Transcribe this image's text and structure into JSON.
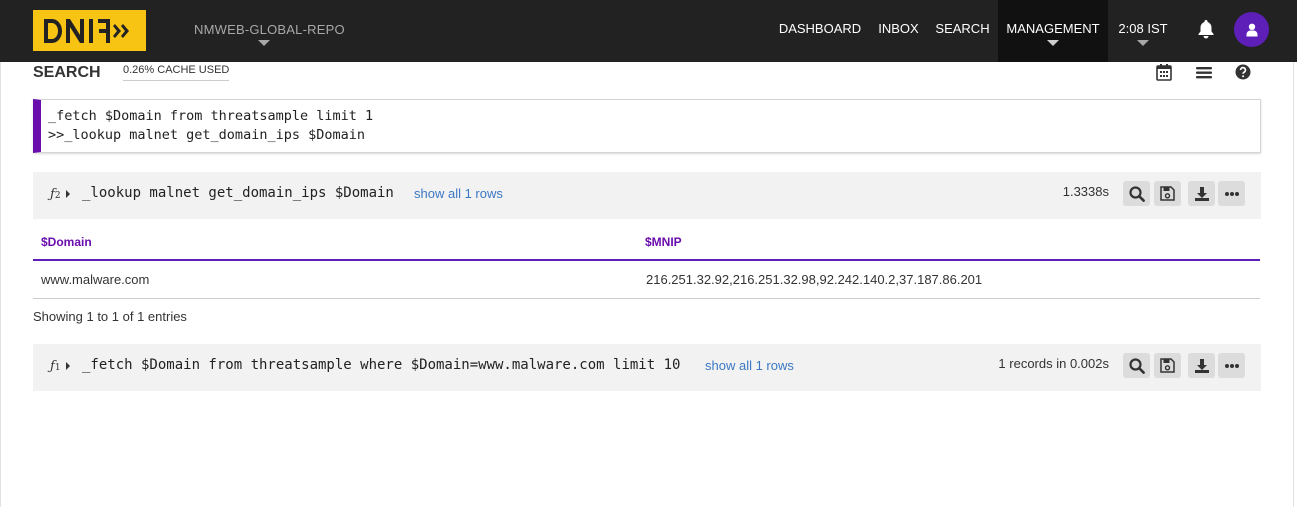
{
  "app": {
    "logo_text": "DNIF",
    "repo_name": "NMWEB-GLOBAL-REPO",
    "brand_color": "#f7c413",
    "accent_color": "#6a0dad"
  },
  "nav": {
    "dashboard": "DASHBOARD",
    "inbox": "INBOX",
    "search": "SEARCH",
    "management": "MANAGEMENT",
    "time": "2:08 IST",
    "bell_icon": "bell-icon",
    "user_icon": "user-icon"
  },
  "search": {
    "title": "SEARCH",
    "cache_used": "0.26% CACHE USED",
    "tools": [
      "calendar-icon",
      "list-icon",
      "help-icon"
    ]
  },
  "editor": {
    "lines": [
      "_fetch $Domain from threatsample limit 1",
      ">>_lookup malnet get_domain_ips $Domain"
    ]
  },
  "panels": [
    {
      "fn_label": "ƒ",
      "fn_index": "2",
      "query": "_lookup malnet get_domain_ips $Domain",
      "show_all": "show all 1 rows",
      "meta": "1.3338s",
      "buttons": [
        "search-icon",
        "save-icon",
        "download-icon",
        "more-icon"
      ],
      "table": {
        "columns": [
          "$Domain",
          "$MNIP"
        ],
        "rows": [
          [
            "www.malware.com",
            "216.251.32.92,216.251.32.98,92.242.140.2,37.187.86.201"
          ]
        ]
      },
      "entries": "Showing 1 to 1 of 1 entries"
    },
    {
      "fn_label": "ƒ",
      "fn_index": "1",
      "query": "_fetch $Domain from threatsample where $Domain=www.malware.com limit 10",
      "show_all": "show all 1 rows",
      "meta": "1 records in 0.002s",
      "buttons": [
        "search-icon",
        "save-icon",
        "download-icon",
        "more-icon"
      ]
    }
  ]
}
